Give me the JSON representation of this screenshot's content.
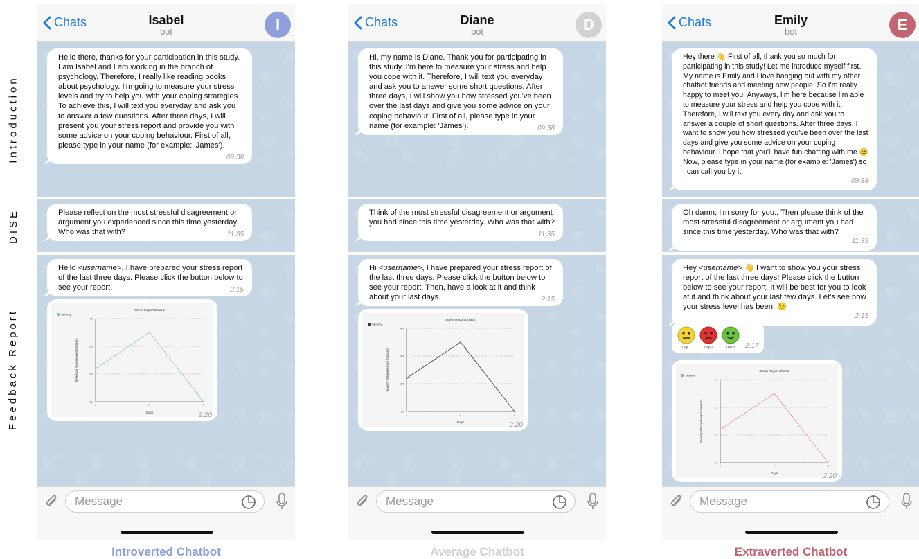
{
  "row_labels": {
    "introduction": "Introduction",
    "dise": "DISE",
    "feedback": "Feedback Report"
  },
  "colors": {
    "introverted": "#8f9fdc",
    "average": "#d2d2d2",
    "extraverted": "#c36570",
    "link": "#1f7ae0",
    "chat_bg": "#c6d6e4"
  },
  "phones": [
    {
      "back_label": "Chats",
      "name": "Isabel",
      "subtitle": "bot",
      "avatar_letter": "I",
      "intro": {
        "text": "Hello there, thanks for your participation in this study. I am Isabel and I am working in the branch of psychology. Therefore, I really like reading books about psychology. I'm going to measure your stress levels and try to help you with your coping strategies. To achieve this, I will text you everyday and ask you to answer a few questions. After three days, I will present you your stress report and provide you with some advice on your coping behaviour. First of all, please type in your name (for example: 'James').",
        "time": "09:38"
      },
      "dise": {
        "text": "Please reflect on the most stressful disagreement or argument you experienced since this time yesterday. Who was that with?",
        "time": "11:35"
      },
      "feedback": {
        "prefix": "Hello ",
        "username": "<username>",
        "suffix": ", I have prepared your stress report of the last three days. Please click the button below to see your report.",
        "time": "2:15"
      },
      "chart_time": "2:20",
      "input_placeholder": "Message",
      "caption": "Introverted Chatbot"
    },
    {
      "back_label": "Chats",
      "name": "Diane",
      "subtitle": "bot",
      "avatar_letter": "D",
      "intro": {
        "text": "Hi, my name is Diane. Thank you for participating in this study. I'm here to measure your stress and help you cope with it. Therefore, I will text you everyday and ask you to answer some short questions. After three days, I will show you how stressed you've been over the last days and give you some advice on your coping behaviour. First of all, please type in your name (for example: 'James').",
        "time": "09:38"
      },
      "dise": {
        "text": "Think of the most stressful disagreement or argument you had since this time yesterday. Who was that with?",
        "time": "11:35"
      },
      "feedback": {
        "prefix": "Hi ",
        "username": "<username>",
        "suffix": ", I have prepared your stress report of the last three days. Please click the button below to see your report. Then, have a look at it and think about your last days.",
        "time": "2:15"
      },
      "chart_time": "2:20",
      "input_placeholder": "Message",
      "caption": "Average Chatbot"
    },
    {
      "back_label": "Chats",
      "name": "Emily",
      "subtitle": "bot",
      "avatar_letter": "E",
      "intro": {
        "text": "Hey there 👋 First of all, thank you so much for participating in this study! Let me introduce myself first. My name is Emily and I love hanging out with my other chatbot friends and meeting new people. So I'm really happy to meet you! Anyways, I'm here because I'm able to measure your stress and help you cope with it. Therefore, I will text you every day and ask you to answer a couple of short questions. After three days, I want to show you how stressed you've been over the last days and give you some advice on your coping behaviour. I hope that you'll have fun chatting with me 😊 Now, please type in your name (for example: 'James') so I can call you by it.",
        "time": "09:38"
      },
      "dise": {
        "text": "Oh damn, I'm sorry for you.. Then please think of the most stressful disagreement or argument you had since this time yesterday. Who was that with?",
        "time": "11:35"
      },
      "feedback": {
        "prefix": "Hey ",
        "username": "<username>",
        "suffix": " 👋 I want to show you your stress report of the last three days! Please click the button below to see your report. It will be best for you to look at it and think about your last few days. Let's see how your stress level has been. 😉",
        "time": "2:15"
      },
      "faces": {
        "labels": [
          "Day 1",
          "Day 2",
          "Day 3"
        ],
        "time": "2:17"
      },
      "chart_time": "2:20",
      "input_placeholder": "Message",
      "caption": "Extraverted Chatbot"
    }
  ],
  "chart_data": [
    {
      "type": "line",
      "title": "Stress Report Chart 2",
      "xlabel": "Days",
      "ylabel": "Severity of Experienced Stressors",
      "legend": "Severity",
      "x": [
        1,
        2,
        3
      ],
      "y": [
        2.2,
        3.5,
        1.0
      ],
      "ylim": [
        1.0,
        4.0
      ],
      "yticks": [
        "1.0",
        "2.0",
        "3.0",
        "4.0"
      ],
      "xticks": [
        "1",
        "2",
        "3"
      ],
      "color": "#7fc9cf",
      "legend_position": "top-left"
    },
    {
      "type": "line",
      "title": "Stress Report Chart 2",
      "xlabel": "Days",
      "ylabel": "Severity of Experienced Stressors",
      "legend": "Severity",
      "x": [
        1,
        2,
        3
      ],
      "y": [
        2.2,
        3.5,
        1.0
      ],
      "ylim": [
        1.0,
        4.0
      ],
      "yticks": [
        "1.0",
        "2.0",
        "3.0",
        "4.0"
      ],
      "xticks": [
        "1",
        "2",
        "3"
      ],
      "color": "#333333",
      "legend_position": "top-left"
    },
    {
      "type": "line",
      "title": "Stress Report Chart 2",
      "xlabel": "Days",
      "ylabel": "Severity of Experienced Stressors",
      "legend": "Severity",
      "x": [
        1,
        2,
        3
      ],
      "y": [
        2.2,
        3.5,
        1.0
      ],
      "ylim": [
        1.0,
        4.0
      ],
      "yticks": [
        "1.0",
        "2.0",
        "3.0",
        "4.0"
      ],
      "xticks": [
        "1",
        "2",
        "3"
      ],
      "color": "#f08a96",
      "legend_position": "top-left"
    }
  ]
}
